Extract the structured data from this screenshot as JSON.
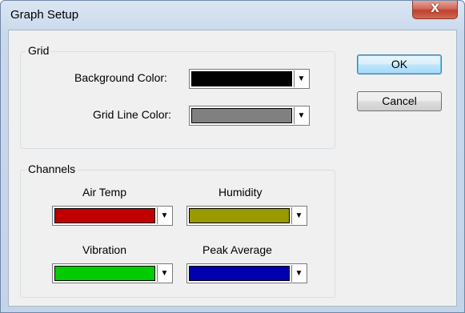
{
  "window": {
    "title": "Graph Setup",
    "close_glyph": "X"
  },
  "grid": {
    "label": "Grid",
    "background_color": {
      "label": "Background Color:",
      "color": "#000000"
    },
    "grid_line_color": {
      "label": "Grid Line Color:",
      "color": "#808080"
    }
  },
  "channels": {
    "label": "Channels",
    "air_temp": {
      "label": "Air Temp",
      "color": "#c00000"
    },
    "humidity": {
      "label": "Humidity",
      "color": "#999900"
    },
    "vibration": {
      "label": "Vibration",
      "color": "#00cc00"
    },
    "peak_average": {
      "label": "Peak Average",
      "color": "#0000b0"
    }
  },
  "buttons": {
    "ok": "OK",
    "cancel": "Cancel"
  },
  "icons": {
    "close": "close-icon",
    "dropdown": "chevron-down-icon"
  }
}
